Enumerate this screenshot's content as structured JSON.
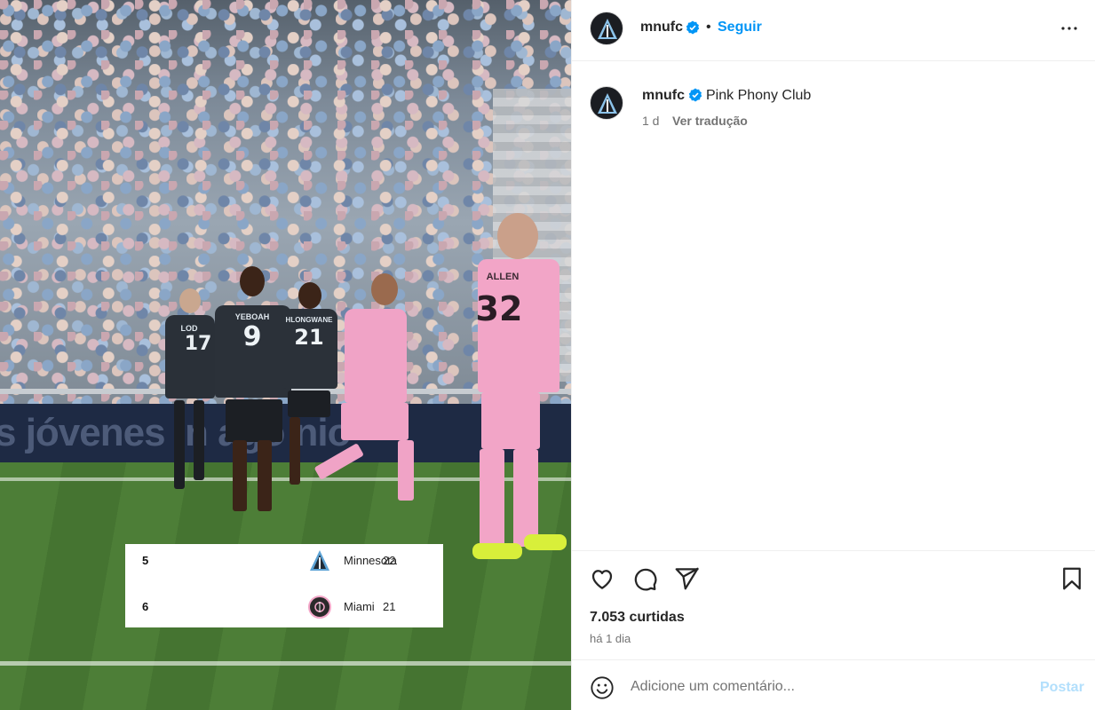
{
  "post_header": {
    "username": "mnufc",
    "separator": "•",
    "follow_label": "Seguir"
  },
  "caption": {
    "username": "mnufc",
    "text": "Pink Phony Club",
    "time": "1 d",
    "translate_label": "Ver tradução"
  },
  "photo": {
    "adboard_text": "s jóvenes in ago nio",
    "players": [
      {
        "name": "LOD",
        "number": "17"
      },
      {
        "name": "YEBOAH",
        "number": "9"
      },
      {
        "name": "HLONGWANE",
        "number": "21"
      },
      {
        "name": "",
        "number": ""
      },
      {
        "name": "ALLEN",
        "number": "32"
      }
    ],
    "standings": [
      {
        "position": "5",
        "team": "Minnesota",
        "points": "22"
      },
      {
        "position": "6",
        "team": "Miami",
        "points": "21"
      }
    ]
  },
  "actions": {
    "likes_text": "7.053 curtidas",
    "posted_text": "há 1 dia"
  },
  "comment_box": {
    "placeholder": "Adicione um comentário...",
    "post_label": "Postar"
  },
  "colors": {
    "accent": "#0095f6",
    "post_disabled": "#b2dffc",
    "verified": "#0095f6",
    "miami_pink": "#f3a6c8",
    "minnesota_dark": "#22282f"
  },
  "icons": [
    "verified-badge-icon",
    "more-options-icon",
    "heart-icon",
    "comment-icon",
    "share-icon",
    "bookmark-icon",
    "emoji-icon"
  ]
}
